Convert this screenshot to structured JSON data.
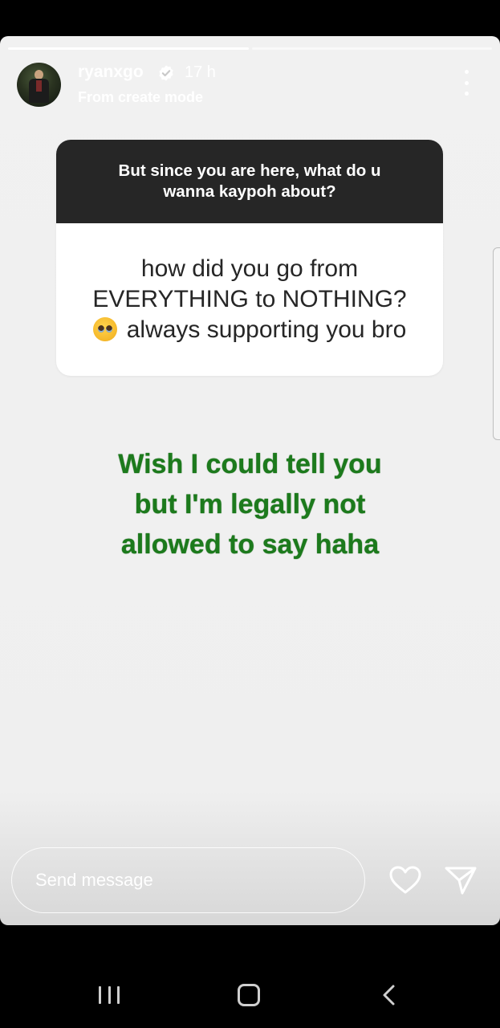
{
  "story": {
    "progress_segments": 2,
    "progress_current": 1,
    "username": "ryanxgo",
    "verified": true,
    "time": "17 h",
    "subtitle": "From create mode",
    "more_icon": "more-vertical-icon"
  },
  "question_sticker": {
    "prompt": "But since you are here, what do u wanna kaypoh about?",
    "answer_line1": "how did you go from",
    "answer_line2": "EVERYTHING to NOTHING?",
    "emoji": "pleading-face-emoji",
    "answer_line3": "always supporting you bro"
  },
  "caption": {
    "line1": "Wish I could tell you",
    "line2": "but I'm legally not",
    "line3": "allowed to say haha",
    "color": "#1c7a1c"
  },
  "reply_bar": {
    "placeholder": "Send message",
    "like_icon": "heart-icon",
    "share_icon": "send-icon"
  },
  "system_nav": {
    "recent_icon": "recent-apps-icon",
    "home_icon": "home-icon",
    "back_icon": "back-icon"
  }
}
